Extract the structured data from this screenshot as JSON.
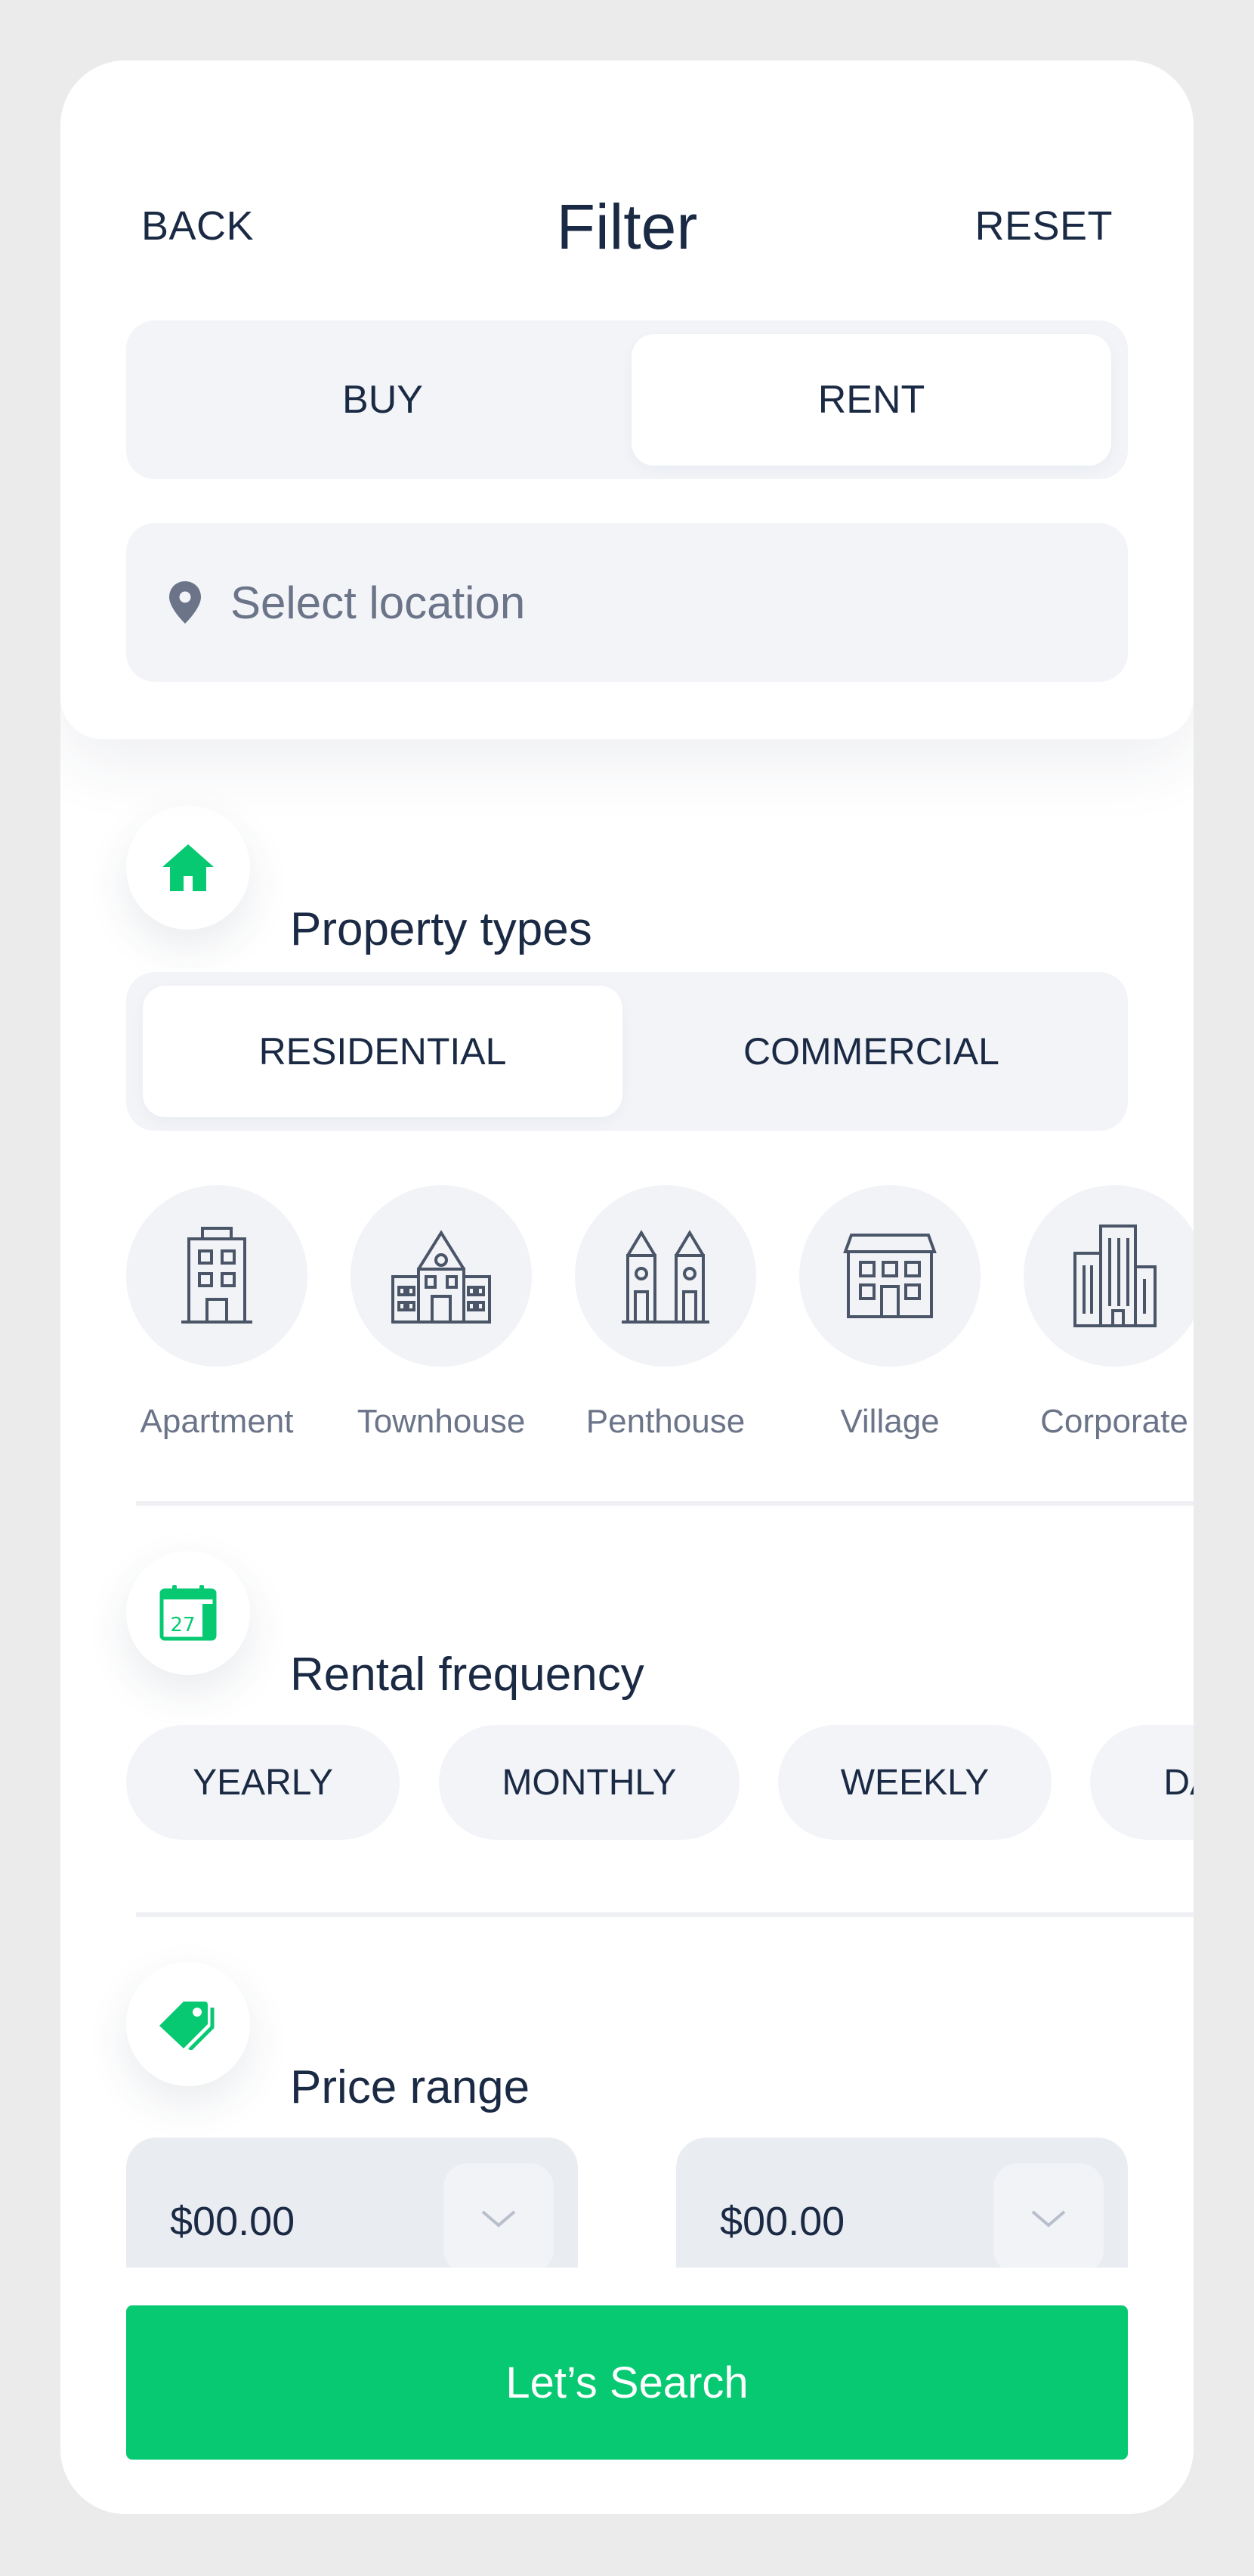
{
  "header": {
    "back_label": "BACK",
    "title": "Filter",
    "reset_label": "RESET"
  },
  "mode_toggle": {
    "options": [
      "BUY",
      "RENT"
    ],
    "selected": "RENT"
  },
  "location": {
    "placeholder": "Select location"
  },
  "property_types": {
    "title": "Property types",
    "category_toggle": {
      "options": [
        "RESIDENTIAL",
        "COMMERCIAL"
      ],
      "selected": "RESIDENTIAL"
    },
    "items": [
      {
        "label": "Apartment",
        "icon": "apartment-icon"
      },
      {
        "label": "Townhouse",
        "icon": "townhouse-icon"
      },
      {
        "label": "Penthouse",
        "icon": "penthouse-icon"
      },
      {
        "label": "Village",
        "icon": "village-icon"
      },
      {
        "label": "Corporate",
        "icon": "corporate-icon"
      }
    ]
  },
  "rental_frequency": {
    "title": "Rental frequency",
    "calendar_day": "27",
    "options": [
      "YEARLY",
      "MONTHLY",
      "WEEKLY",
      "DAILY"
    ]
  },
  "price_range": {
    "title": "Price range",
    "min": {
      "value": "$00.00"
    },
    "max": {
      "value": "$00.00"
    }
  },
  "search_button": {
    "label": "Let’s Search"
  },
  "colors": {
    "accent": "#07c972",
    "text_dark": "#1b2a44",
    "text_muted": "#6b7488",
    "surface": "#f2f4f8",
    "background": "#ebebec"
  }
}
